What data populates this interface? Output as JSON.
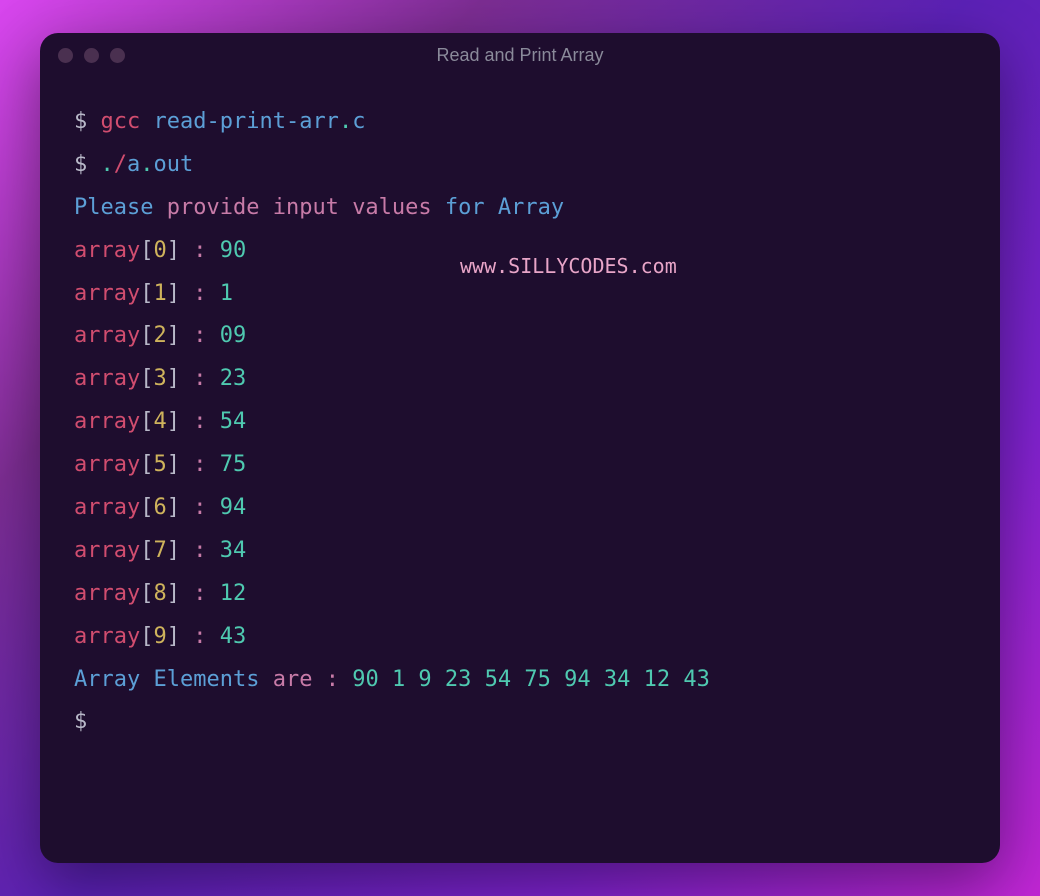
{
  "window": {
    "title": "Read and Print Array"
  },
  "watermark": "www.SILLYCODES.com",
  "terminal": {
    "prompt": "$",
    "cmd1_cmd": "gcc",
    "cmd1_arg": "read-print-arr",
    "cmd1_dot": ".",
    "cmd1_ext": "c",
    "cmd2_dot1": ".",
    "cmd2_slash": "/",
    "cmd2_a": "a",
    "cmd2_dot2": ".",
    "cmd2_out": "out",
    "header_please": "Please",
    "header_provide": "provide",
    "header_input": "input",
    "header_values": "values",
    "header_for": "for",
    "header_array": "Array",
    "array_label": "array",
    "entries": [
      {
        "idx": "0",
        "val": "90"
      },
      {
        "idx": "1",
        "val": "1"
      },
      {
        "idx": "2",
        "val": "09"
      },
      {
        "idx": "3",
        "val": "23"
      },
      {
        "idx": "4",
        "val": "54"
      },
      {
        "idx": "5",
        "val": "75"
      },
      {
        "idx": "6",
        "val": "94"
      },
      {
        "idx": "7",
        "val": "34"
      },
      {
        "idx": "8",
        "val": "12"
      },
      {
        "idx": "9",
        "val": "43"
      }
    ],
    "result_array": "Array",
    "result_elements": "Elements",
    "result_are": "are",
    "result_colon": ":",
    "result_values": "90 1 9 23 54 75 94 34 12 43"
  }
}
